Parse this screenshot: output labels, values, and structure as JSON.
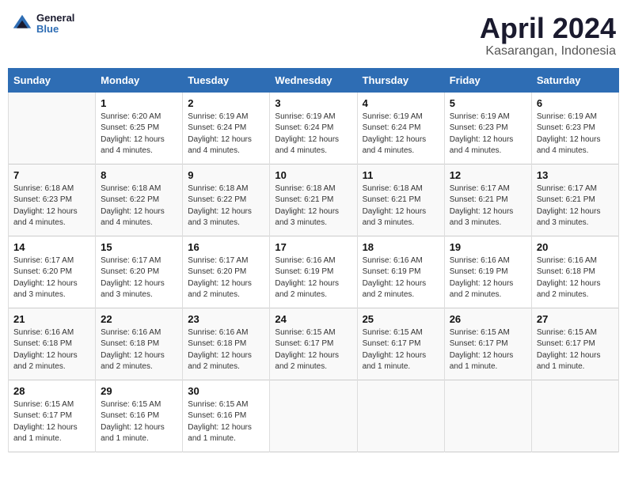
{
  "header": {
    "logo_general": "General",
    "logo_blue": "Blue",
    "month_title": "April 2024",
    "subtitle": "Kasarangan, Indonesia"
  },
  "days_of_week": [
    "Sunday",
    "Monday",
    "Tuesday",
    "Wednesday",
    "Thursday",
    "Friday",
    "Saturday"
  ],
  "weeks": [
    [
      {
        "day": "",
        "info": ""
      },
      {
        "day": "1",
        "info": "Sunrise: 6:20 AM\nSunset: 6:25 PM\nDaylight: 12 hours\nand 4 minutes."
      },
      {
        "day": "2",
        "info": "Sunrise: 6:19 AM\nSunset: 6:24 PM\nDaylight: 12 hours\nand 4 minutes."
      },
      {
        "day": "3",
        "info": "Sunrise: 6:19 AM\nSunset: 6:24 PM\nDaylight: 12 hours\nand 4 minutes."
      },
      {
        "day": "4",
        "info": "Sunrise: 6:19 AM\nSunset: 6:24 PM\nDaylight: 12 hours\nand 4 minutes."
      },
      {
        "day": "5",
        "info": "Sunrise: 6:19 AM\nSunset: 6:23 PM\nDaylight: 12 hours\nand 4 minutes."
      },
      {
        "day": "6",
        "info": "Sunrise: 6:19 AM\nSunset: 6:23 PM\nDaylight: 12 hours\nand 4 minutes."
      }
    ],
    [
      {
        "day": "7",
        "info": "Sunrise: 6:18 AM\nSunset: 6:23 PM\nDaylight: 12 hours\nand 4 minutes."
      },
      {
        "day": "8",
        "info": "Sunrise: 6:18 AM\nSunset: 6:22 PM\nDaylight: 12 hours\nand 4 minutes."
      },
      {
        "day": "9",
        "info": "Sunrise: 6:18 AM\nSunset: 6:22 PM\nDaylight: 12 hours\nand 3 minutes."
      },
      {
        "day": "10",
        "info": "Sunrise: 6:18 AM\nSunset: 6:21 PM\nDaylight: 12 hours\nand 3 minutes."
      },
      {
        "day": "11",
        "info": "Sunrise: 6:18 AM\nSunset: 6:21 PM\nDaylight: 12 hours\nand 3 minutes."
      },
      {
        "day": "12",
        "info": "Sunrise: 6:17 AM\nSunset: 6:21 PM\nDaylight: 12 hours\nand 3 minutes."
      },
      {
        "day": "13",
        "info": "Sunrise: 6:17 AM\nSunset: 6:21 PM\nDaylight: 12 hours\nand 3 minutes."
      }
    ],
    [
      {
        "day": "14",
        "info": "Sunrise: 6:17 AM\nSunset: 6:20 PM\nDaylight: 12 hours\nand 3 minutes."
      },
      {
        "day": "15",
        "info": "Sunrise: 6:17 AM\nSunset: 6:20 PM\nDaylight: 12 hours\nand 3 minutes."
      },
      {
        "day": "16",
        "info": "Sunrise: 6:17 AM\nSunset: 6:20 PM\nDaylight: 12 hours\nand 2 minutes."
      },
      {
        "day": "17",
        "info": "Sunrise: 6:16 AM\nSunset: 6:19 PM\nDaylight: 12 hours\nand 2 minutes."
      },
      {
        "day": "18",
        "info": "Sunrise: 6:16 AM\nSunset: 6:19 PM\nDaylight: 12 hours\nand 2 minutes."
      },
      {
        "day": "19",
        "info": "Sunrise: 6:16 AM\nSunset: 6:19 PM\nDaylight: 12 hours\nand 2 minutes."
      },
      {
        "day": "20",
        "info": "Sunrise: 6:16 AM\nSunset: 6:18 PM\nDaylight: 12 hours\nand 2 minutes."
      }
    ],
    [
      {
        "day": "21",
        "info": "Sunrise: 6:16 AM\nSunset: 6:18 PM\nDaylight: 12 hours\nand 2 minutes."
      },
      {
        "day": "22",
        "info": "Sunrise: 6:16 AM\nSunset: 6:18 PM\nDaylight: 12 hours\nand 2 minutes."
      },
      {
        "day": "23",
        "info": "Sunrise: 6:16 AM\nSunset: 6:18 PM\nDaylight: 12 hours\nand 2 minutes."
      },
      {
        "day": "24",
        "info": "Sunrise: 6:15 AM\nSunset: 6:17 PM\nDaylight: 12 hours\nand 2 minutes."
      },
      {
        "day": "25",
        "info": "Sunrise: 6:15 AM\nSunset: 6:17 PM\nDaylight: 12 hours\nand 1 minute."
      },
      {
        "day": "26",
        "info": "Sunrise: 6:15 AM\nSunset: 6:17 PM\nDaylight: 12 hours\nand 1 minute."
      },
      {
        "day": "27",
        "info": "Sunrise: 6:15 AM\nSunset: 6:17 PM\nDaylight: 12 hours\nand 1 minute."
      }
    ],
    [
      {
        "day": "28",
        "info": "Sunrise: 6:15 AM\nSunset: 6:17 PM\nDaylight: 12 hours\nand 1 minute."
      },
      {
        "day": "29",
        "info": "Sunrise: 6:15 AM\nSunset: 6:16 PM\nDaylight: 12 hours\nand 1 minute."
      },
      {
        "day": "30",
        "info": "Sunrise: 6:15 AM\nSunset: 6:16 PM\nDaylight: 12 hours\nand 1 minute."
      },
      {
        "day": "",
        "info": ""
      },
      {
        "day": "",
        "info": ""
      },
      {
        "day": "",
        "info": ""
      },
      {
        "day": "",
        "info": ""
      }
    ]
  ]
}
